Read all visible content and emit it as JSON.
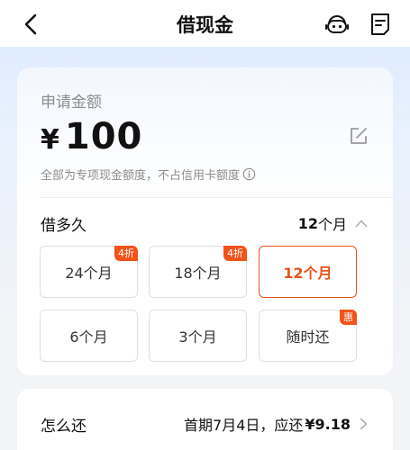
{
  "navbar": {
    "title": "借现金",
    "back_icon": "back-arrow-icon",
    "service_icon": "customer-service-icon",
    "doc_icon": "document-icon"
  },
  "amount": {
    "label": "申请金额",
    "currency": "¥",
    "value": "100",
    "note": "全部为专项现金额度，不占信用卡额度",
    "edit_icon": "edit-icon",
    "info_icon": "info-icon"
  },
  "term": {
    "label": "借多久",
    "selected_num": "12",
    "selected_unit": "个月",
    "options": [
      {
        "label": "24个月",
        "badge": "4折",
        "selected": false
      },
      {
        "label": "18个月",
        "badge": "4折",
        "selected": false
      },
      {
        "label": "12个月",
        "badge": "",
        "selected": true
      },
      {
        "label": "6个月",
        "badge": "",
        "selected": false
      },
      {
        "label": "3个月",
        "badge": "",
        "selected": false
      },
      {
        "label": "随时还",
        "badge": "惠",
        "selected": false
      }
    ]
  },
  "repay": {
    "label": "怎么还",
    "info": "首期7月4日，应还",
    "amount": "¥9.18"
  },
  "colors": {
    "accent": "#e8531b",
    "badge": "#f25319"
  }
}
